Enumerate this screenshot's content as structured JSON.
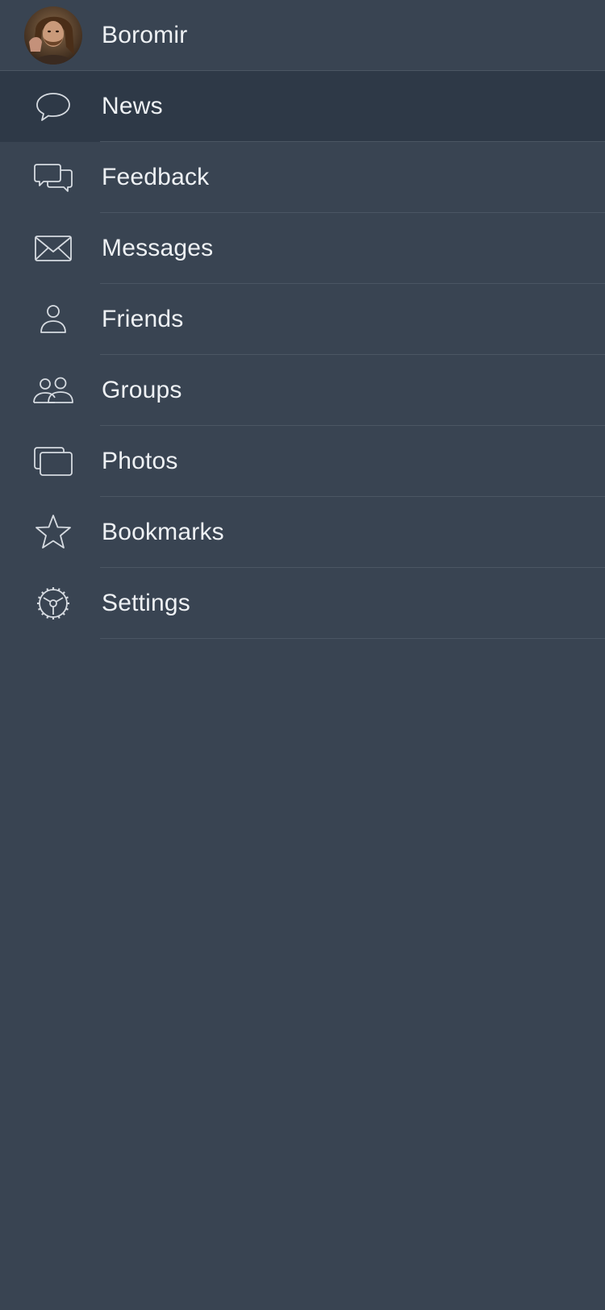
{
  "profile": {
    "name": "Boromir"
  },
  "menu": {
    "items": [
      {
        "label": "News",
        "icon": "speech-bubble-icon",
        "selected": true
      },
      {
        "label": "Feedback",
        "icon": "double-speech-bubble-icon",
        "selected": false
      },
      {
        "label": "Messages",
        "icon": "envelope-icon",
        "selected": false
      },
      {
        "label": "Friends",
        "icon": "person-icon",
        "selected": false
      },
      {
        "label": "Groups",
        "icon": "people-icon",
        "selected": false
      },
      {
        "label": "Photos",
        "icon": "photos-icon",
        "selected": false
      },
      {
        "label": "Bookmarks",
        "icon": "star-icon",
        "selected": false
      },
      {
        "label": "Settings",
        "icon": "gear-icon",
        "selected": false
      }
    ]
  },
  "colors": {
    "background": "#394452",
    "selected_background": "#2e3947",
    "text": "#eef1f4",
    "icon": "#d6dbe1",
    "divider": "#4b5663"
  }
}
